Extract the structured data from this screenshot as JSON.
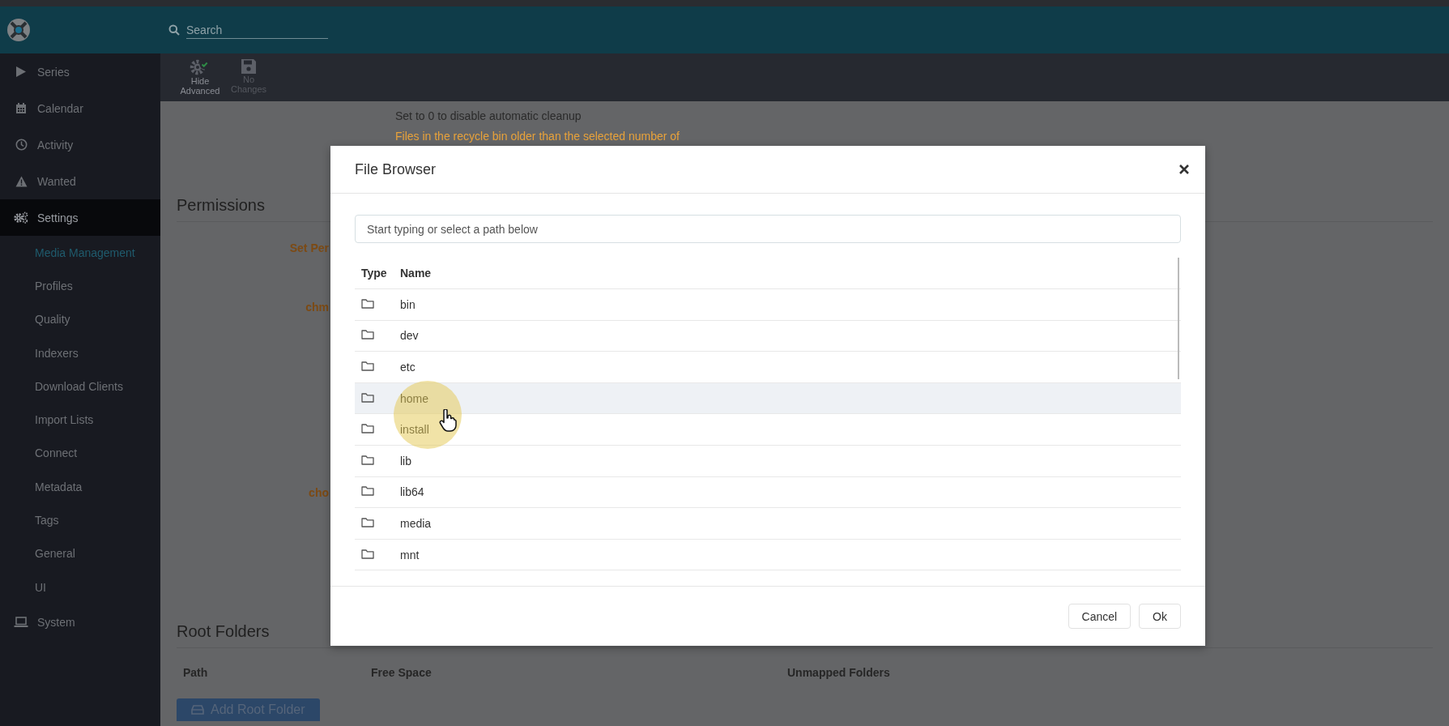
{
  "header": {
    "search": {
      "placeholder": "Search"
    }
  },
  "sidebar": {
    "items": [
      {
        "label": "Series",
        "active": false
      },
      {
        "label": "Calendar",
        "active": false
      },
      {
        "label": "Activity",
        "active": false
      },
      {
        "label": "Wanted",
        "active": false
      },
      {
        "label": "Settings",
        "active": true,
        "children": [
          {
            "label": "Media Management",
            "selected": true
          },
          {
            "label": "Profiles",
            "selected": false
          },
          {
            "label": "Quality",
            "selected": false
          },
          {
            "label": "Indexers",
            "selected": false
          },
          {
            "label": "Download Clients",
            "selected": false
          },
          {
            "label": "Import Lists",
            "selected": false
          },
          {
            "label": "Connect",
            "selected": false
          },
          {
            "label": "Metadata",
            "selected": false
          },
          {
            "label": "Tags",
            "selected": false
          },
          {
            "label": "General",
            "selected": false
          },
          {
            "label": "UI",
            "selected": false
          }
        ]
      },
      {
        "label": "System",
        "active": false
      }
    ]
  },
  "toolbar": {
    "buttons": [
      {
        "label": "Hide Advanced",
        "disabled": false
      },
      {
        "label": "No Changes",
        "disabled": true
      }
    ]
  },
  "settings": {
    "help_texts": [
      {
        "kind": "info",
        "text": "Set to 0 to disable automatic cleanup"
      },
      {
        "kind": "warning",
        "text": "Files in the recycle bin older than the selected number of"
      }
    ],
    "permissions": {
      "title": "Permissions",
      "labels": [
        "Set Per",
        "chm",
        "cho"
      ]
    },
    "root_folders": {
      "title": "Root Folders",
      "columns": [
        "Path",
        "Free Space",
        "Unmapped Folders"
      ],
      "add_button": "Add Root Folder"
    }
  },
  "dialog": {
    "title": "File Browser",
    "path_field": {
      "placeholder": "Start typing or select a path below"
    },
    "columns": [
      "Type",
      "Name"
    ],
    "rows": [
      {
        "name": "bin",
        "highlighted": false
      },
      {
        "name": "dev",
        "highlighted": false
      },
      {
        "name": "etc",
        "highlighted": false
      },
      {
        "name": "home",
        "highlighted": true
      },
      {
        "name": "install",
        "highlighted": false
      },
      {
        "name": "lib",
        "highlighted": false
      },
      {
        "name": "lib64",
        "highlighted": false
      },
      {
        "name": "media",
        "highlighted": false
      },
      {
        "name": "mnt",
        "highlighted": false
      }
    ],
    "buttons": [
      "Cancel",
      "Ok"
    ]
  }
}
